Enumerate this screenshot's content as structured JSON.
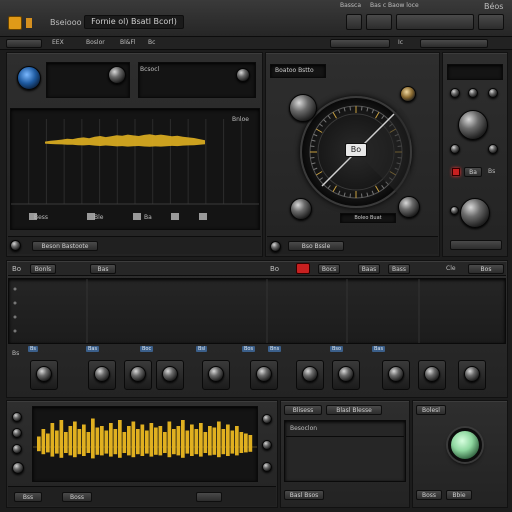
{
  "titlebar": {
    "app_label": "Bseiooo",
    "title": "Fornie ol) Bsatl Bcorl)",
    "right_label": "Béos",
    "menu_items": [
      "Bassca",
      "Bas c Baow loce"
    ]
  },
  "toolbar": {
    "items": [
      "EEX",
      "Boslor",
      "Bl&Fl",
      "Bc"
    ],
    "right_label": "Ic"
  },
  "analyzer": {
    "header_labels": [
      "Bcsocl",
      "Bnloe"
    ],
    "bottom_labels": [
      "Bess",
      "Ble",
      "Ba"
    ],
    "footer_label": "Beson Bastoote",
    "amplitudes": [
      0.05,
      0.08,
      0.1,
      0.12,
      0.15,
      0.14,
      0.18,
      0.2,
      0.17,
      0.22,
      0.25,
      0.21,
      0.24,
      0.28,
      0.26,
      0.3,
      0.27,
      0.25,
      0.29,
      0.31,
      0.28,
      0.3,
      0.27,
      0.24,
      0.26,
      0.22,
      0.2,
      0.18,
      0.14,
      0.1
    ]
  },
  "dial": {
    "header_label": "Boatoo Bstto",
    "center_label": "Bo",
    "footer_label": "Bso Bssle",
    "footer_value": "Boleo Buat"
  },
  "side_panel": {
    "right_label": "Bs",
    "value": "Ba"
  },
  "mixer": {
    "left_labels": [
      "Bo",
      "Bonls",
      "Bas"
    ],
    "right_labels": [
      "Bocs",
      "Baas",
      "Bass"
    ],
    "far_right": [
      "Cle",
      "Bos"
    ],
    "tags": [
      "Bs",
      "Bas",
      "Boc",
      "Bsl",
      "Bos",
      "Bns",
      "Bso",
      "Bas"
    ],
    "side_labels": [
      "Bo",
      "Bs",
      "Bs",
      "B"
    ]
  },
  "waveform": {
    "amplitudes": [
      0.35,
      0.6,
      0.45,
      0.8,
      0.55,
      0.9,
      0.5,
      0.7,
      0.85,
      0.6,
      0.75,
      0.5,
      0.95,
      0.65,
      0.7,
      0.55,
      0.8,
      0.6,
      0.9,
      0.5,
      0.7,
      0.85,
      0.6,
      0.75,
      0.55,
      0.8,
      0.65,
      0.7,
      0.5,
      0.85,
      0.6,
      0.7,
      0.9,
      0.55,
      0.75,
      0.6,
      0.8,
      0.5,
      0.7,
      0.65,
      0.85,
      0.6,
      0.75,
      0.55,
      0.7,
      0.5,
      0.45,
      0.4
    ],
    "footer_labels": [
      "Bss",
      "Boss"
    ]
  },
  "center_panel": {
    "header_items": [
      "Blisess",
      "Blasl Blesse"
    ],
    "list_label": "Besoclon",
    "footer_label": "Basl Bsos"
  },
  "right_bottom": {
    "header_label": "Bolesl",
    "footer_labels": [
      "Boss",
      "Bbie"
    ]
  },
  "colors": {
    "accent_yellow": "#e0b020",
    "led_red": "#c82020",
    "tag_blue": "#3b5f8a",
    "button_green": "#8fd8a0"
  }
}
